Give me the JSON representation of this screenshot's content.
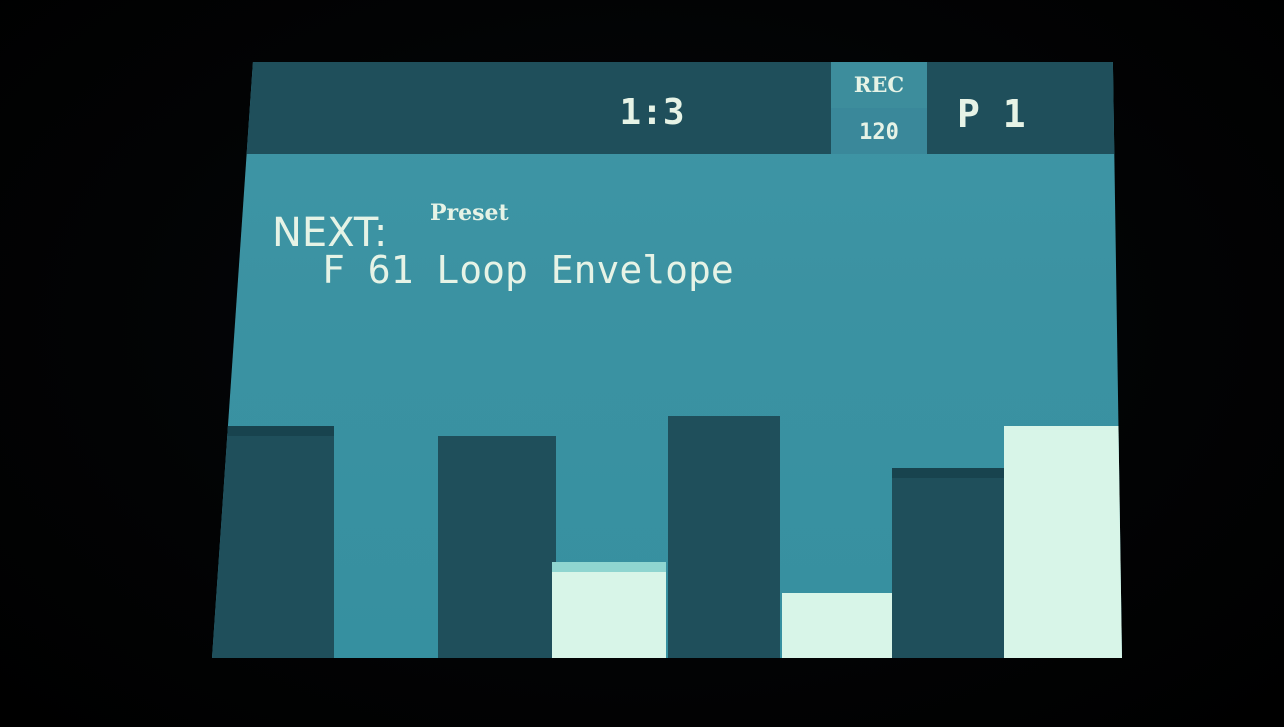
{
  "header": {
    "position": "1:3",
    "rec_label": "REC",
    "bpm": "120",
    "pattern": "P 1"
  },
  "main": {
    "next_label": "NEXT:",
    "preset_label": "Preset",
    "preset_name": "F 61 Loop Envelope"
  },
  "colors": {
    "bar_dark": "#1f4f5b",
    "bar_light": "#d8f5e8",
    "screen_bg": "#3b92a2"
  }
}
